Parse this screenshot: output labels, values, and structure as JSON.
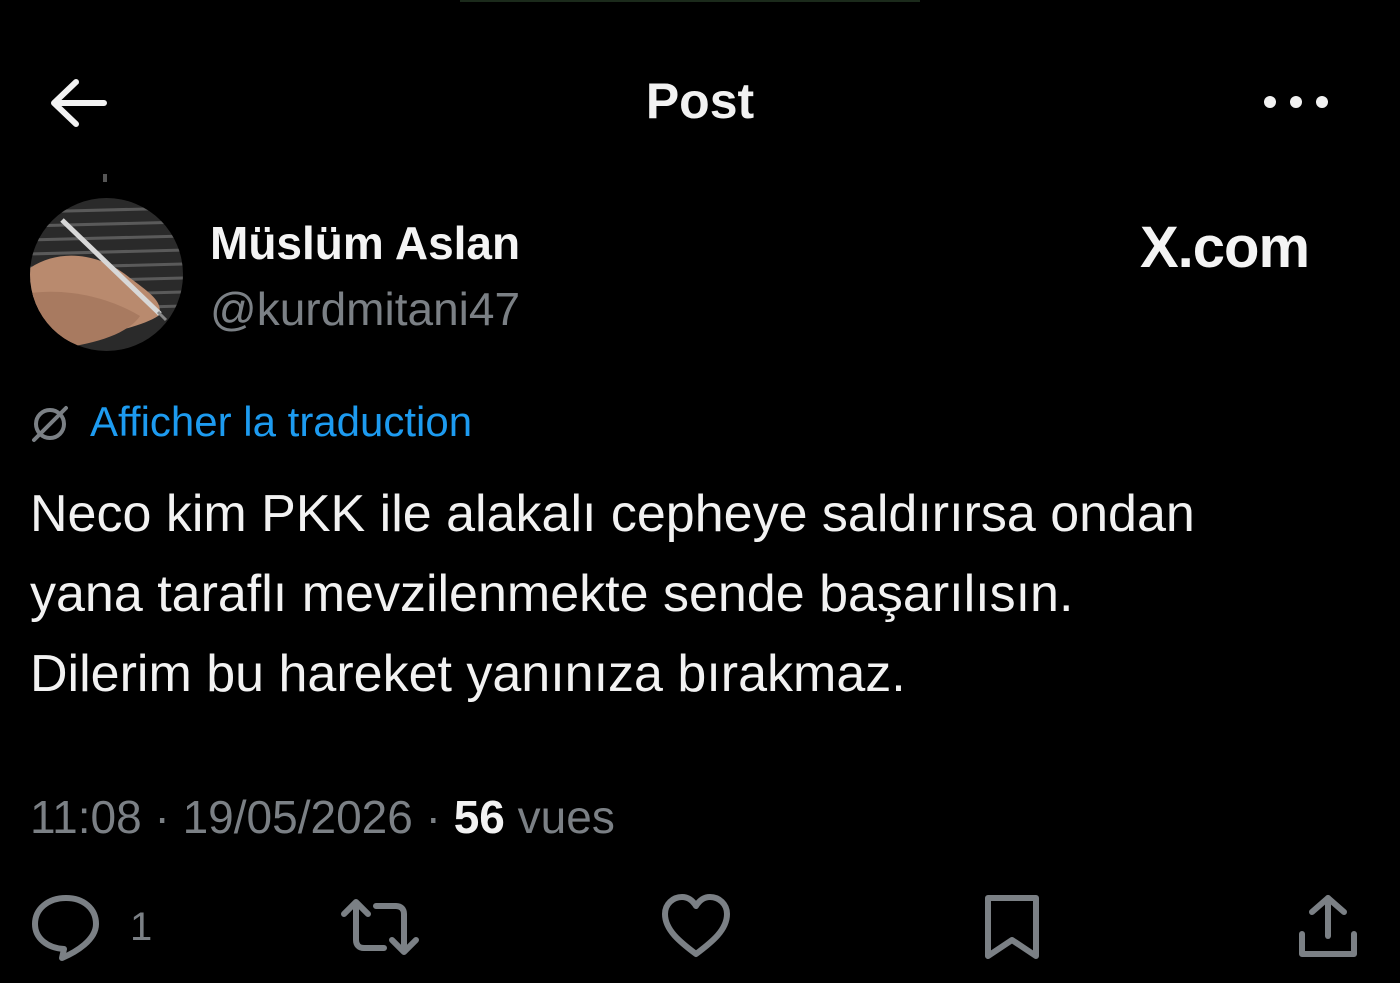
{
  "header": {
    "title": "Post"
  },
  "author": {
    "name": "Müslüm Aslan",
    "handle": "@kurdmitani47"
  },
  "brand": {
    "label": "X.com"
  },
  "translate": {
    "label": "Afficher la traduction"
  },
  "post": {
    "lines": [
      "Neco kim PKK ile alakalı cepheye saldırırsa ondan",
      "yana taraflı mevzilenmekte sende başarılısın.",
      "Dilerim bu hareket yanınıza bırakmaz."
    ]
  },
  "meta": {
    "time": "11:08",
    "date": "19/05/2026",
    "separator": "·",
    "views_count": "56",
    "views_label": "vues"
  },
  "actions": {
    "reply_count": "1"
  },
  "icons": [
    "back-arrow-icon",
    "more-icon",
    "translate-icon",
    "reply-icon",
    "repost-icon",
    "like-icon",
    "bookmark-icon",
    "share-icon"
  ],
  "colors": {
    "background": "#000000",
    "text": "#e7e9ea",
    "secondary": "#7b8085",
    "link": "#1d9bf0"
  }
}
